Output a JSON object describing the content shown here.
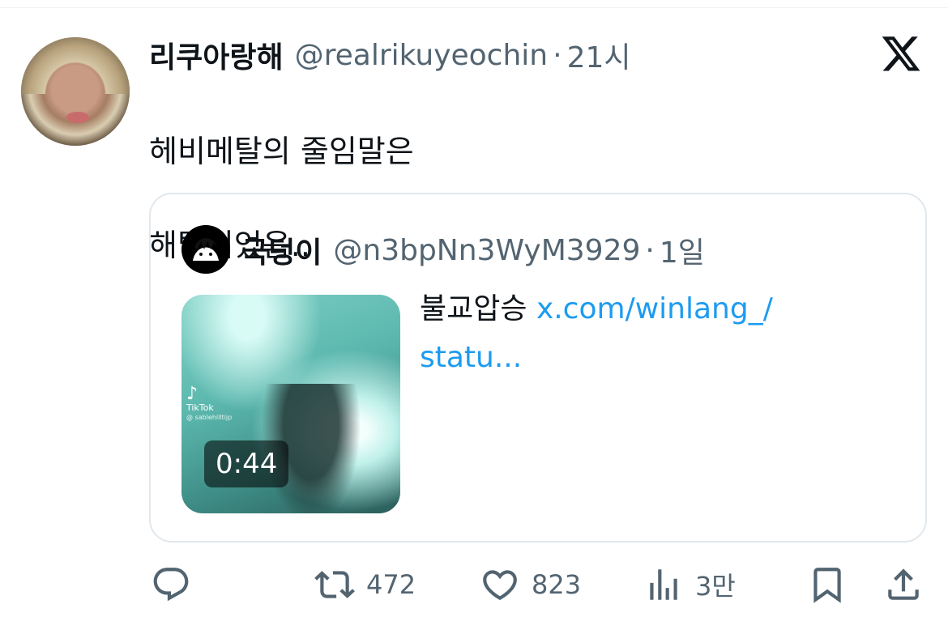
{
  "tweet": {
    "display_name": "리쿠아랑해",
    "handle": "@realrikuyeochin",
    "separator": "·",
    "time": "21시",
    "text_line1": "헤비메탈의 줄임말은",
    "text_line2": "해탈이었음.."
  },
  "quote": {
    "display_name": "국덩이",
    "handle": "@n3bpNn3WyM3929",
    "separator": "·",
    "time": "1일",
    "text": "불교압승 ",
    "link_text": "x.com/winlang_/\nstatu...",
    "media": {
      "duration": "0:44",
      "watermark_brand": "TikTok",
      "watermark_handle": "@ sablehilltijp"
    }
  },
  "actions": {
    "reply_icon": "reply-icon",
    "retweet_count": "472",
    "like_count": "823",
    "views_count": "3만",
    "bookmark_icon": "bookmark-icon",
    "share_icon": "share-icon"
  },
  "colors": {
    "text": "#0f1419",
    "secondary": "#536471",
    "link": "#1d9bf0",
    "border": "#e1e8ed"
  }
}
